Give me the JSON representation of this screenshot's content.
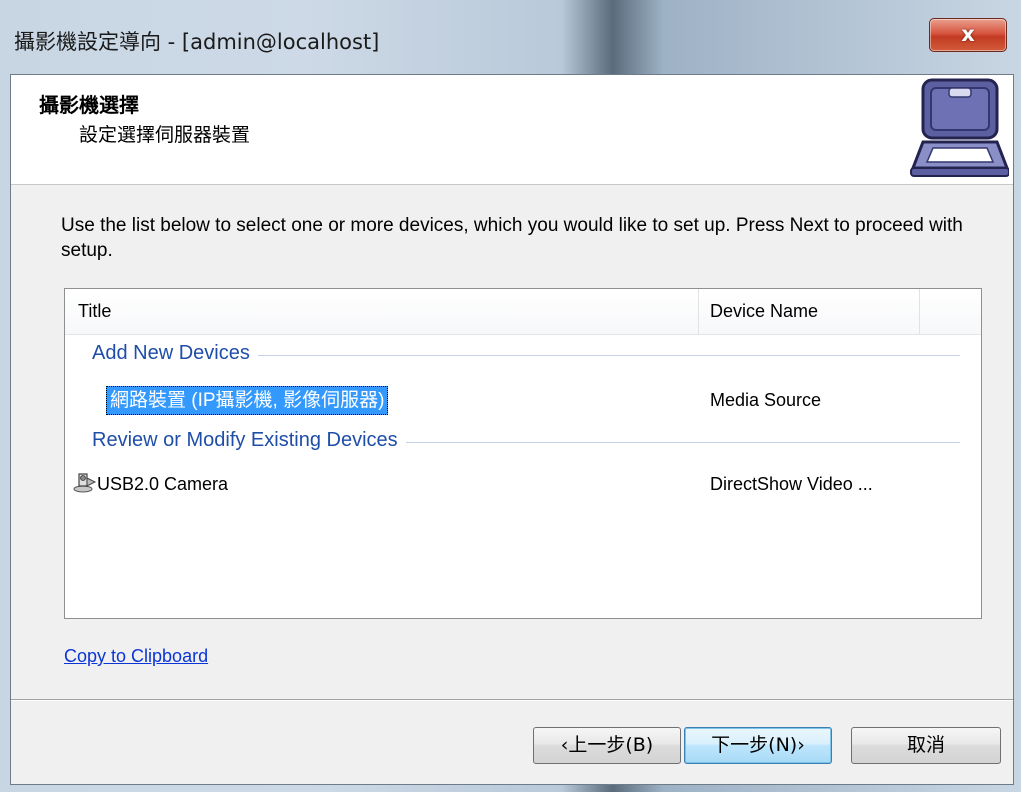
{
  "window": {
    "title": "攝影機設定導向 - [admin@localhost]",
    "close_label": "x"
  },
  "header": {
    "title": "攝影機選擇",
    "subtitle": "設定選擇伺服器裝置",
    "icon": "device-setup-icon"
  },
  "instructions": "Use the list below to select one or more devices, which you would like to set up. Press Next to proceed with setup.",
  "list": {
    "columns": [
      "Title",
      "Device Name"
    ],
    "groups": [
      {
        "label": "Add New Devices",
        "items": [
          {
            "title": "網路裝置 (IP攝影機, 影像伺服器)",
            "device_name": "Media Source",
            "selected": true
          }
        ]
      },
      {
        "label": "Review or Modify Existing Devices",
        "items": [
          {
            "title": "USB2.0 Camera",
            "device_name": "DirectShow Video ...",
            "icon": "camera-icon",
            "selected": false
          }
        ]
      }
    ]
  },
  "link": "Copy to Clipboard",
  "buttons": {
    "back": "‹上一步(B)",
    "next": "下一步(N)›",
    "cancel": "取消"
  },
  "colors": {
    "selection": "#3399ff",
    "group_text": "#1e4ea8",
    "link": "#0b36d6",
    "close_button": "#c23a22"
  }
}
